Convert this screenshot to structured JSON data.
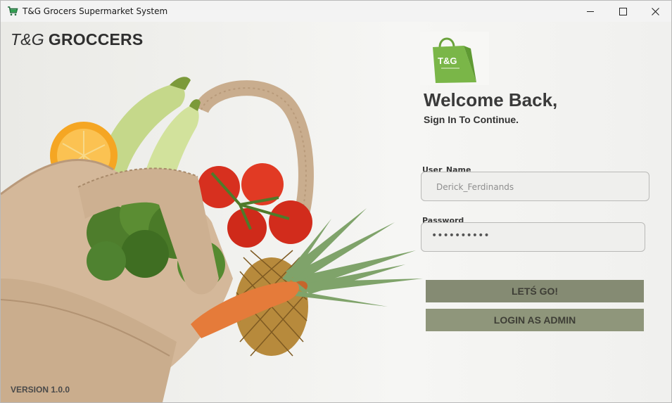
{
  "window": {
    "title": "T&G Grocers Supermarket System",
    "controls": [
      "minimize-icon",
      "maximize-icon",
      "close-icon"
    ]
  },
  "brand": {
    "prefix": "T&G",
    "name": "GROCCERS"
  },
  "logo": {
    "text": "T&G"
  },
  "welcome": {
    "heading": "Welcome Back,",
    "subheading": "Sign In To Continue."
  },
  "form": {
    "username_label": "User_Name",
    "username_value": "Derick_Ferdinands",
    "password_label": "Password",
    "password_value": "••••••••••"
  },
  "buttons": {
    "go": "LETŚ GO!",
    "admin": "LOGIN AS ADMIN"
  },
  "footer": {
    "version": "VERSION 1.0.0"
  },
  "colors": {
    "accent_button": "#858b73",
    "admin_button": "#8f967b",
    "logo_green": "#7ab648"
  }
}
